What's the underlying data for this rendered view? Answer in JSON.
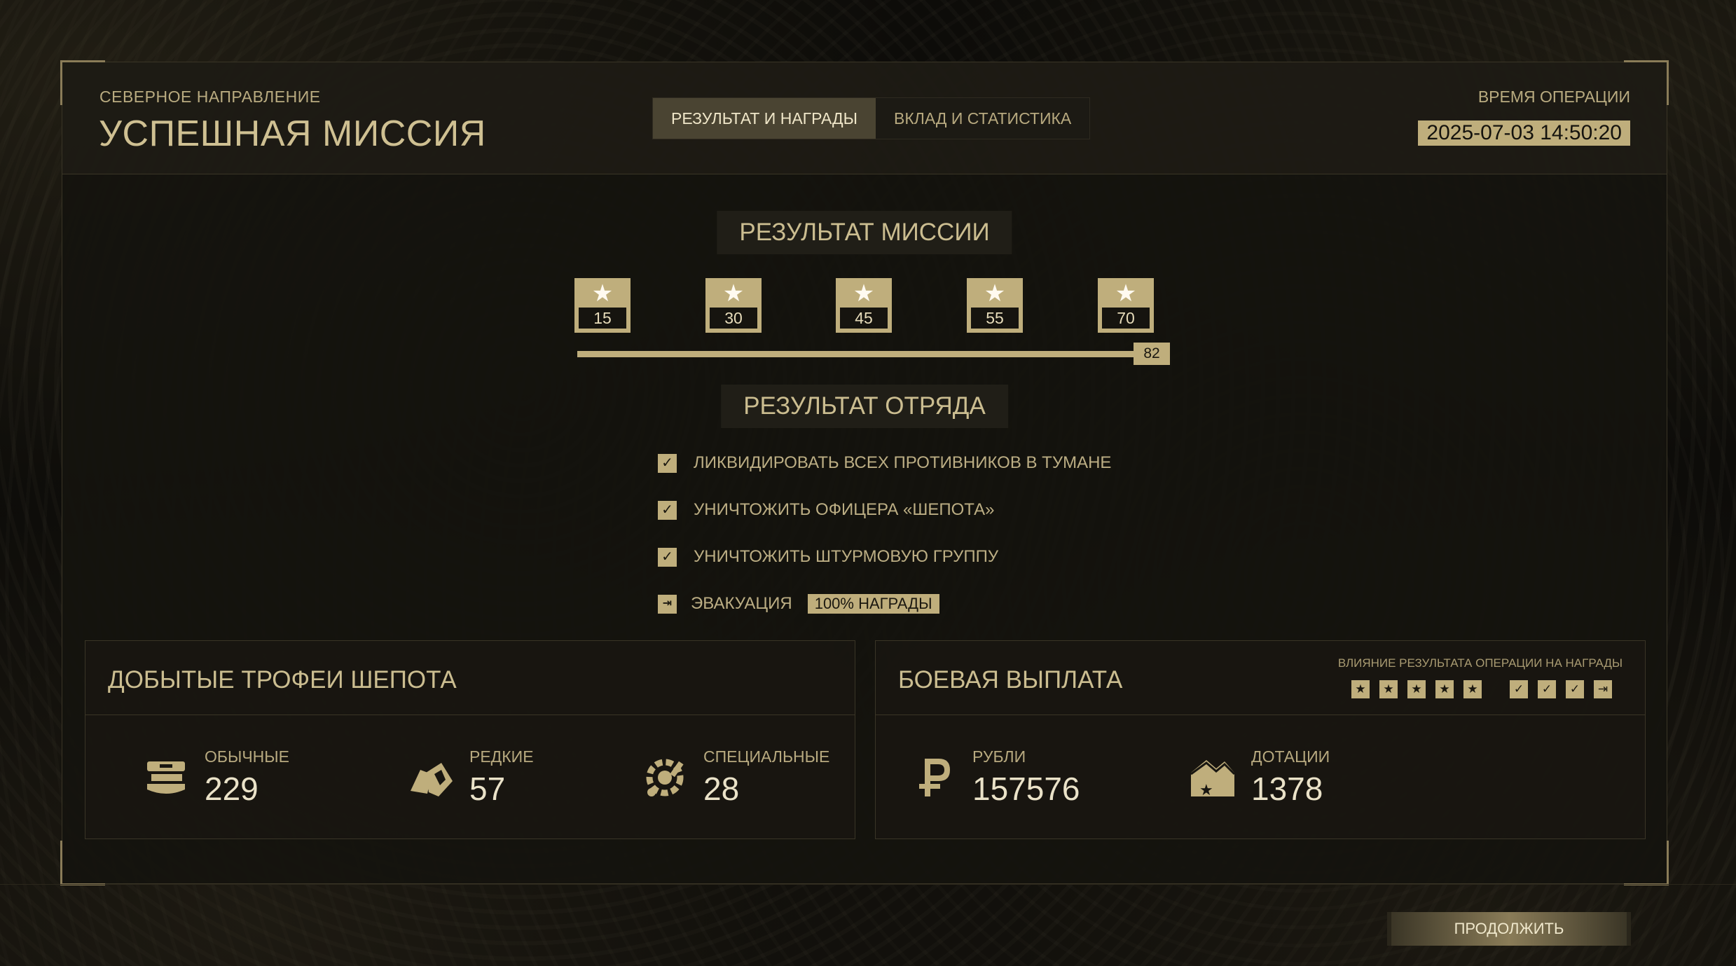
{
  "header": {
    "direction": "СЕВЕРНОЕ НАПРАВЛЕНИЕ",
    "title": "УСПЕШНАЯ МИССИЯ",
    "tabs": [
      {
        "label": "РЕЗУЛЬТАТ И НАГРАДЫ",
        "active": true
      },
      {
        "label": "ВКЛАД И СТАТИСТИКА",
        "active": false
      }
    ],
    "op_time_label": "ВРЕМЯ ОПЕРАЦИИ",
    "op_time_value": "2025-07-03 14:50:20"
  },
  "mission_result": {
    "title": "РЕЗУЛЬТАТ МИССИИ",
    "thresholds": [
      "15",
      "30",
      "45",
      "55",
      "70"
    ],
    "score": "82",
    "progress_fraction": 1.0
  },
  "squad_result": {
    "title": "РЕЗУЛЬТАТ ОТРЯДА",
    "objectives": [
      {
        "label": "ЛИКВИДИРОВАТЬ ВСЕХ ПРОТИВНИКОВ В ТУМАНЕ",
        "checked": true
      },
      {
        "label": "УНИЧТОЖИТЬ ОФИЦЕРА «ШЕПОТА»",
        "checked": true
      },
      {
        "label": "УНИЧТОЖИТЬ ШТУРМОВУЮ ГРУППУ",
        "checked": true
      }
    ],
    "evacuation": {
      "label": "ЭВАКУАЦИЯ",
      "badge": "100% НАГРАДЫ"
    }
  },
  "trophies": {
    "title": "ДОБЫТЫЕ ТРОФЕИ ШЕПОТА",
    "items": [
      {
        "label": "ОБЫЧНЫЕ",
        "value": "229",
        "icon": "common-trophy-icon"
      },
      {
        "label": "РЕДКИЕ",
        "value": "57",
        "icon": "rare-trophy-icon"
      },
      {
        "label": "СПЕЦИАЛЬНЫЕ",
        "value": "28",
        "icon": "special-trophy-icon"
      }
    ]
  },
  "payout": {
    "title": "БОЕВАЯ ВЫПЛАТА",
    "influence_label": "ВЛИЯНИЕ РЕЗУЛЬТАТА ОПЕРАЦИИ НА НАГРАДЫ",
    "items": [
      {
        "label": "РУБЛИ",
        "value": "157576",
        "icon": "ruble-icon"
      },
      {
        "label": "ДОТАЦИИ",
        "value": "1378",
        "icon": "subsidy-icon"
      }
    ]
  },
  "footer": {
    "continue_label": "ПРОДОЛЖИТЬ"
  },
  "colors": {
    "accent": "#bfae7c",
    "panel": "#181611",
    "text": "#c9bb8c"
  }
}
